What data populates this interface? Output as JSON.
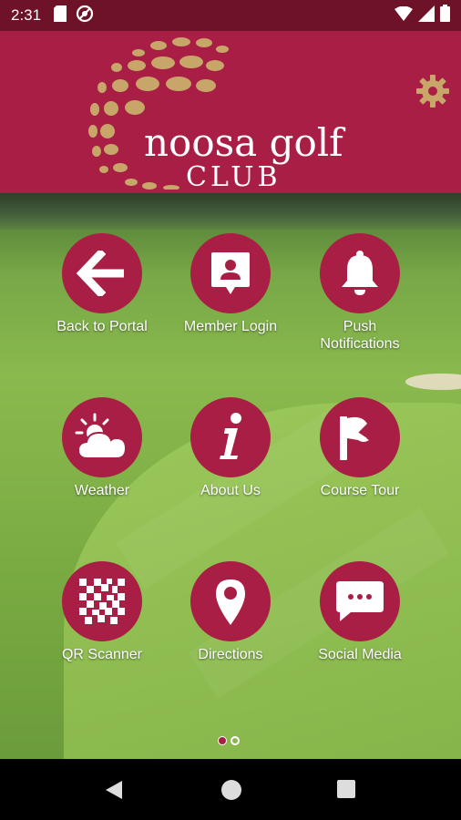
{
  "status_bar": {
    "time": "2:31",
    "left_icons": [
      "sd-card-icon",
      "no-disturb-icon"
    ],
    "right_icons": [
      "wifi-icon",
      "signal-icon",
      "battery-icon"
    ]
  },
  "header": {
    "logo_line1": "noosa golf",
    "logo_line2": "CLUB",
    "settings_icon": "gear-icon"
  },
  "grid": {
    "items": [
      {
        "label": "Back to Portal",
        "icon": "arrow-left-icon"
      },
      {
        "label": "Member Login",
        "icon": "member-id-icon"
      },
      {
        "label": "Push Notifications",
        "icon": "bell-icon"
      },
      {
        "label": "Weather",
        "icon": "weather-icon"
      },
      {
        "label": "About Us",
        "icon": "info-icon"
      },
      {
        "label": "Course Tour",
        "icon": "flag-icon"
      },
      {
        "label": "QR Scanner",
        "icon": "qr-icon"
      },
      {
        "label": "Directions",
        "icon": "location-pin-icon"
      },
      {
        "label": "Social Media",
        "icon": "chat-icon"
      }
    ]
  },
  "pager": {
    "page_count": 2,
    "active_page": 1
  },
  "colors": {
    "brand": "#a81e44",
    "status_bar": "#6e1227",
    "logo_gold": "#c8a66a"
  }
}
